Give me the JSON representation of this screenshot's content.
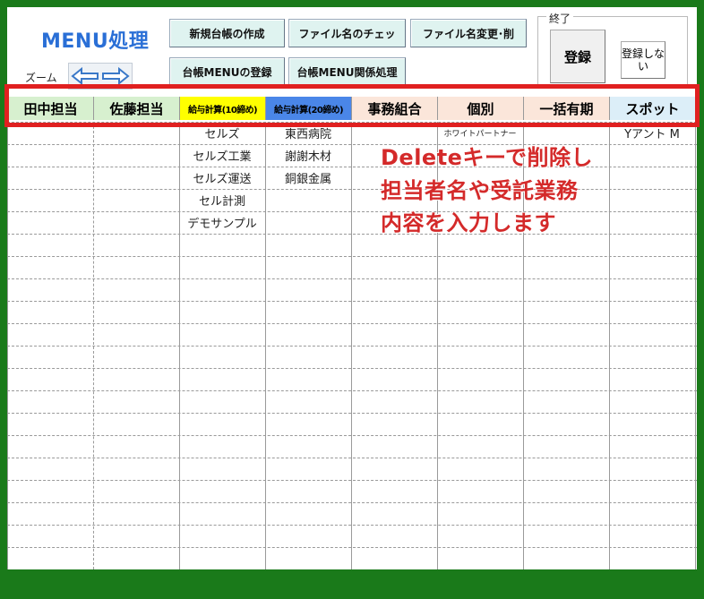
{
  "title": "MENU処理",
  "toolbar": {
    "buttons": [
      "新規台帳の作成",
      "ファイル名のチェッ",
      "ファイル名変更･削",
      "台帳MENUの登録",
      "台帳MENU関係処理"
    ],
    "zoom_label": "ズーム"
  },
  "finish": {
    "group_label": "終了",
    "register": "登録",
    "no_register": "登録しない"
  },
  "columns": [
    {
      "label": "田中担当",
      "bg": "#d7f0cf"
    },
    {
      "label": "佐藤担当",
      "bg": "#d7f0cf"
    },
    {
      "label": "給与計算(10締め)",
      "bg": "#ffff00"
    },
    {
      "label": "給与計算(20締め)",
      "bg": "#4a86e8"
    },
    {
      "label": "事務組合",
      "bg": "#fbe6da"
    },
    {
      "label": "個別",
      "bg": "#fbe6da"
    },
    {
      "label": "一括有期",
      "bg": "#fbe6da"
    },
    {
      "label": "スポット",
      "bg": "#dceef8"
    }
  ],
  "cells": {
    "col3": [
      "セルズ",
      "セルズ工業",
      "セルズ運送",
      "セル計測",
      "デモサンプル"
    ],
    "col4": [
      "東西病院",
      "謝謝木材",
      "銅銀金属"
    ],
    "col6": [
      "ホワイトパートナー"
    ],
    "col8": [
      "Yアント M"
    ]
  },
  "annotation": {
    "line1": "Deleteキーで削除し",
    "line2": "担当者名や受託業務",
    "line3": "内容を入力します"
  },
  "colors": {
    "frame": "#1a7a1a",
    "title": "#2a6fd6",
    "highlight": "#e02020",
    "annotation": "#d42a2a"
  }
}
